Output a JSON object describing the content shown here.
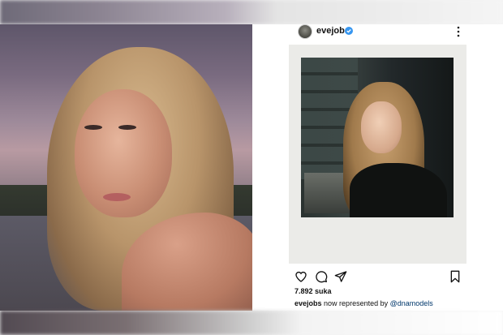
{
  "post": {
    "username": "evejobs",
    "likes": "7.892 suka",
    "caption": {
      "user": "evejobs",
      "text": "now represented by",
      "mention": "@dnamodels"
    }
  },
  "icons": {
    "verified": "verified-badge-icon",
    "more": "more-options-icon",
    "like": "heart-icon",
    "comment": "comment-icon",
    "share": "share-icon",
    "save": "bookmark-icon"
  },
  "colors": {
    "verified": "#3897f0",
    "mention": "#00376b",
    "text": "#111111"
  }
}
